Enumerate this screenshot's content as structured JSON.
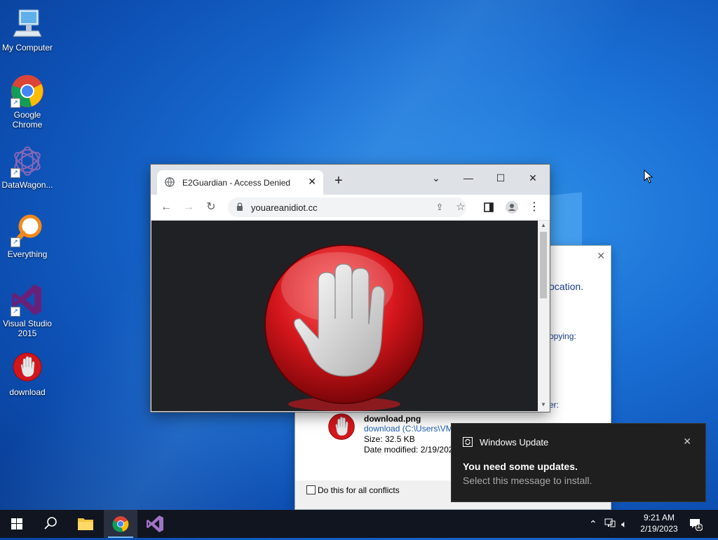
{
  "desktop": {
    "icons": [
      {
        "label": "My Computer",
        "icon": "computer-icon"
      },
      {
        "label": "Google Chrome",
        "icon": "chrome-icon"
      },
      {
        "label": "DataWagon...",
        "icon": "datawagon-icon"
      },
      {
        "label": "Everything",
        "icon": "everything-search-icon"
      },
      {
        "label": "Visual Studio 2015",
        "icon": "visual-studio-icon"
      },
      {
        "label": "download",
        "icon": "stop-hand-icon"
      }
    ]
  },
  "browser": {
    "tab_title": "E2Guardian - Access Denied",
    "url": "youareanidiot.cc",
    "content_image": "stop-hand-icon"
  },
  "dialog": {
    "partial_text_1": "ocation.",
    "partial_text_2": "opying:",
    "partial_text_3": "er:",
    "file_name": "download.png",
    "file_path": "download (C:\\Users\\VM",
    "file_size": "Size: 32.5 KB",
    "file_modified": "Date modified: 2/19/202",
    "checkbox_label": "Do this for all conflicts"
  },
  "notification": {
    "app": "Windows Update",
    "headline": "You need some updates.",
    "body": "Select this message to install."
  },
  "taskbar": {
    "time": "9:21 AM",
    "date": "2/19/2023",
    "notification_count": "1"
  },
  "colors": {
    "desktop_blue": "#1a6fd4",
    "taskbar": "#101520",
    "toast": "#1f1f1f",
    "stop_red": "#d4161c"
  }
}
